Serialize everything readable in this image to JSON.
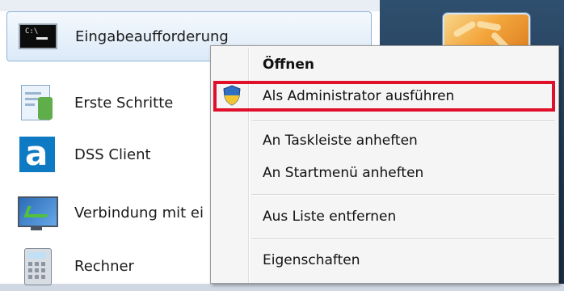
{
  "programs": [
    {
      "label": "Eingabeaufforderung",
      "icon": "command-prompt-icon"
    },
    {
      "label": "Erste Schritte",
      "icon": "getting-started-icon"
    },
    {
      "label": "DSS Client",
      "icon": "dss-client-icon"
    },
    {
      "label": "Verbindung mit ei",
      "icon": "remote-desktop-icon"
    },
    {
      "label": "Rechner",
      "icon": "calculator-icon"
    }
  ],
  "cmd_icon_text": "C:\\",
  "dss_icon_letter": "a",
  "context_menu": {
    "open": "Öffnen",
    "run_as_admin": "Als Administrator ausführen",
    "pin_taskbar": "An Taskleiste anheften",
    "pin_start": "An Startmenü anheften",
    "remove_list": "Aus Liste entfernen",
    "properties": "Eigenschaften"
  },
  "highlight_color": "#e0102a"
}
